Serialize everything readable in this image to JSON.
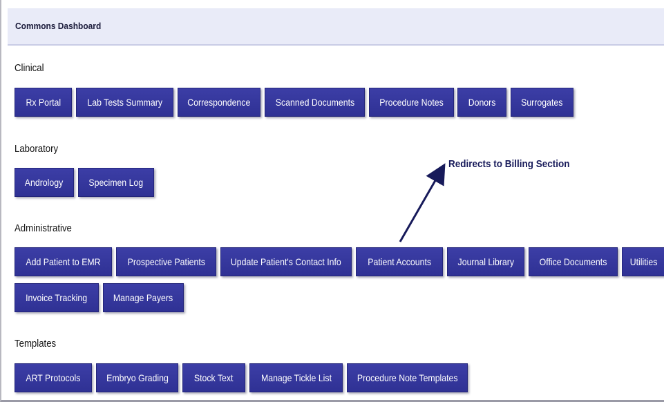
{
  "header": {
    "title": "Commons Dashboard"
  },
  "sections": {
    "clinical": {
      "title": "Clinical",
      "buttons": [
        "Rx Portal",
        "Lab Tests Summary",
        "Correspondence",
        "Scanned Documents",
        "Procedure Notes",
        "Donors",
        "Surrogates"
      ]
    },
    "laboratory": {
      "title": "Laboratory",
      "buttons": [
        "Andrology",
        "Specimen Log"
      ]
    },
    "administrative": {
      "title": "Administrative",
      "buttons": [
        "Add Patient to EMR",
        "Prospective Patients",
        "Update Patient's Contact Info",
        "Patient Accounts",
        "Journal Library",
        "Office Documents",
        "Utilities",
        "Invoice Tracking",
        "Manage Payers"
      ]
    },
    "templates": {
      "title": "Templates",
      "buttons": [
        "ART Protocols",
        "Embryo Grading",
        "Stock Text",
        "Manage Tickle List",
        "Procedure Note Templates"
      ]
    }
  },
  "annotation": {
    "text": "Redirects to Billing Section"
  },
  "colors": {
    "button": "#3336a0",
    "header_bg": "#e9ebf8",
    "annotation": "#171a5a"
  }
}
